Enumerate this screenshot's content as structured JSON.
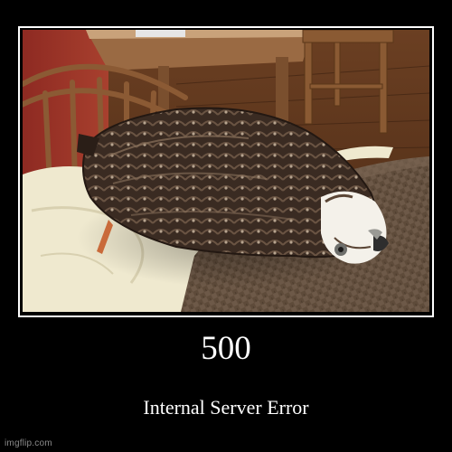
{
  "poster": {
    "title": "500",
    "subtitle": "Internal Server Error",
    "watermark": "imgflip.com"
  },
  "colors": {
    "background": "#000000",
    "frame_border": "#ffffff",
    "text": "#ffffff",
    "watermark": "#8a8a8a"
  }
}
